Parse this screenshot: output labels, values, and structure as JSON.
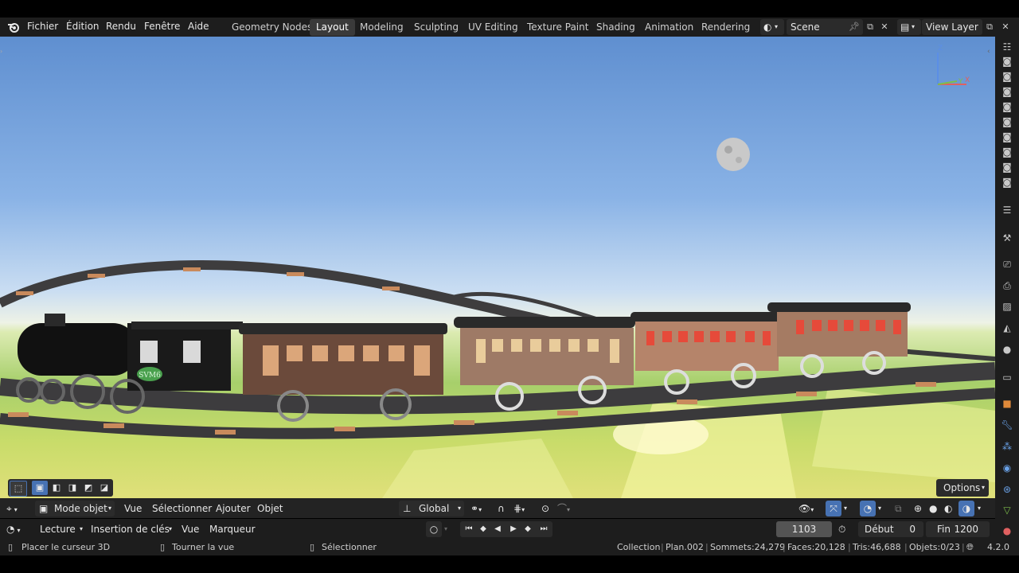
{
  "menu": {
    "items": [
      "Fichier",
      "Édition",
      "Rendu",
      "Fenêtre",
      "Aide"
    ]
  },
  "workspaces": {
    "tabs": [
      "Geometry Nodes",
      "Layout",
      "Modeling",
      "Sculpting",
      "UV Editing",
      "Texture Paint",
      "Shading",
      "Animation",
      "Rendering"
    ],
    "active": "Layout"
  },
  "scene": {
    "name": "Scene",
    "view_layer": "View Layer"
  },
  "viewport": {
    "nav_gizmo": {
      "z": "Z",
      "y": "Y",
      "x": "X"
    },
    "options_label": "Options",
    "loco_label": "SVM6"
  },
  "header": {
    "mode": "Mode objet",
    "vue": "Vue",
    "selectionner": "Sélectionner",
    "ajouter": "Ajouter",
    "objet": "Objet",
    "transform_orientation": "Global"
  },
  "timeline": {
    "playback": "Lecture",
    "keying": "Insertion de clés",
    "view": "Vue",
    "marker": "Marqueur",
    "current_frame": "1103",
    "start_label": "Début",
    "start_value": "0",
    "end_label": "Fin",
    "end_value": "1200"
  },
  "status": {
    "hint1": "Placer le curseur 3D",
    "hint2": "Tourner la vue",
    "hint3": "Sélectionner",
    "collection": "Collection",
    "object": "Plan.002",
    "vertices": "Sommets:24,279",
    "faces": "Faces:20,128",
    "tris": "Tris:46,688",
    "objects": "Objets:0/23",
    "version": "4.2.0"
  },
  "colors": {
    "bar_bg": "#1d1d1d",
    "accent_blue": "#4772b3",
    "active_tab": "#3a3a3a"
  }
}
